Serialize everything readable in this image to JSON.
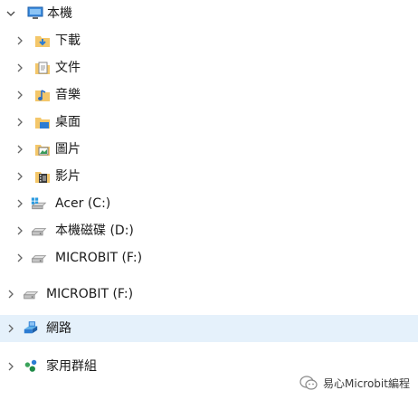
{
  "tree": {
    "this_pc": "本機",
    "downloads": "下載",
    "documents": "文件",
    "music": "音樂",
    "desktop": "桌面",
    "pictures": "圖片",
    "videos": "影片",
    "drive_c": "Acer (C:)",
    "drive_d": "本機磁碟 (D:)",
    "drive_f_nested": "MICROBIT (F:)",
    "drive_f_root": "MICROBIT (F:)",
    "network": "網路",
    "homegroup": "家用群組"
  },
  "watermark": {
    "text": "易心Microbit編程"
  },
  "colors": {
    "selection": "#e5f1fb",
    "folder": "#f4c76a",
    "accent_blue": "#2b7cd3"
  }
}
